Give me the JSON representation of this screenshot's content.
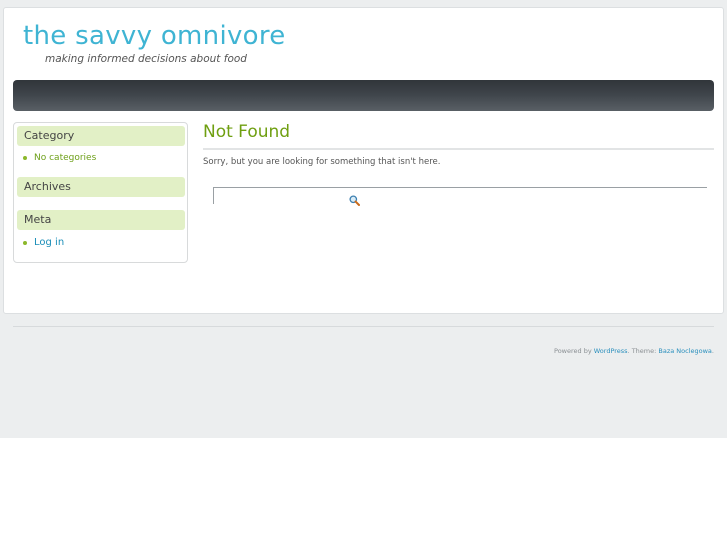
{
  "header": {
    "site_title": "the savvy omnivore",
    "tagline": "making informed decisions about food"
  },
  "sidebar": {
    "category": {
      "title": "Category",
      "item": "No categories"
    },
    "archives": {
      "title": "Archives"
    },
    "meta": {
      "title": "Meta",
      "item": "Log in"
    }
  },
  "main": {
    "title": "Not Found",
    "message": "Sorry, but you are looking for something that isn't here.",
    "search_value": ""
  },
  "footer": {
    "powered_prefix": "Powered by ",
    "wordpress_link": "WordPress",
    "theme_prefix": ". Theme: ",
    "theme_link": "Baza Noclegowa",
    "suffix": "."
  },
  "colors": {
    "accent_blue": "#3fb4d3",
    "accent_green": "#6f9f11",
    "widget_title_bg": "#e2f0c6",
    "navbar_dark": "#3e444a"
  },
  "icons": {
    "search": "magnifier-icon"
  }
}
